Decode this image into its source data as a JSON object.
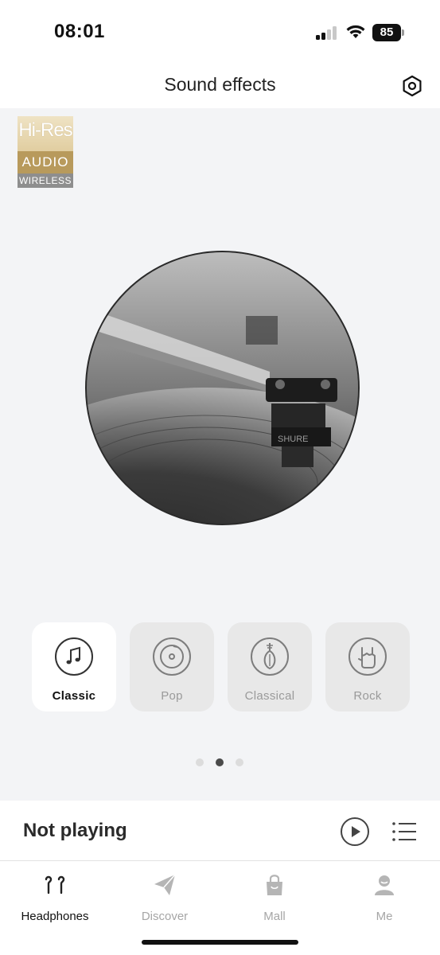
{
  "status_bar": {
    "time": "08:01",
    "battery": "85",
    "icons": [
      "signal-icon",
      "wifi-icon",
      "battery-icon"
    ]
  },
  "header": {
    "title": "Sound effects",
    "settings_icon": "gear-icon"
  },
  "badge": {
    "line1": "Hi-Res",
    "line2": "AUDIO",
    "line3": "WIRELESS"
  },
  "artwork": {
    "logo_text": "SHURE"
  },
  "effects": [
    {
      "label": "Classic",
      "icon": "music-note-icon",
      "selected": true
    },
    {
      "label": "Pop",
      "icon": "vinyl-icon",
      "selected": false
    },
    {
      "label": "Classical",
      "icon": "pipa-icon",
      "selected": false
    },
    {
      "label": "Rock",
      "icon": "rock-hand-icon",
      "selected": false
    }
  ],
  "pagination": {
    "total": 3,
    "current": 2
  },
  "player": {
    "status": "Not playing",
    "play_icon": "play-icon",
    "list_icon": "playlist-icon"
  },
  "tabs": [
    {
      "label": "Headphones",
      "icon": "earbuds-icon",
      "active": true
    },
    {
      "label": "Discover",
      "icon": "paper-plane-icon",
      "active": false
    },
    {
      "label": "Mall",
      "icon": "shopping-bag-icon",
      "active": false
    },
    {
      "label": "Me",
      "icon": "person-icon",
      "active": false
    }
  ],
  "colors": {
    "background": "#f3f4f6",
    "card_inactive": "#e8e8e8",
    "card_active": "#ffffff",
    "text_primary": "#111111",
    "text_muted": "#9a9a9a"
  }
}
